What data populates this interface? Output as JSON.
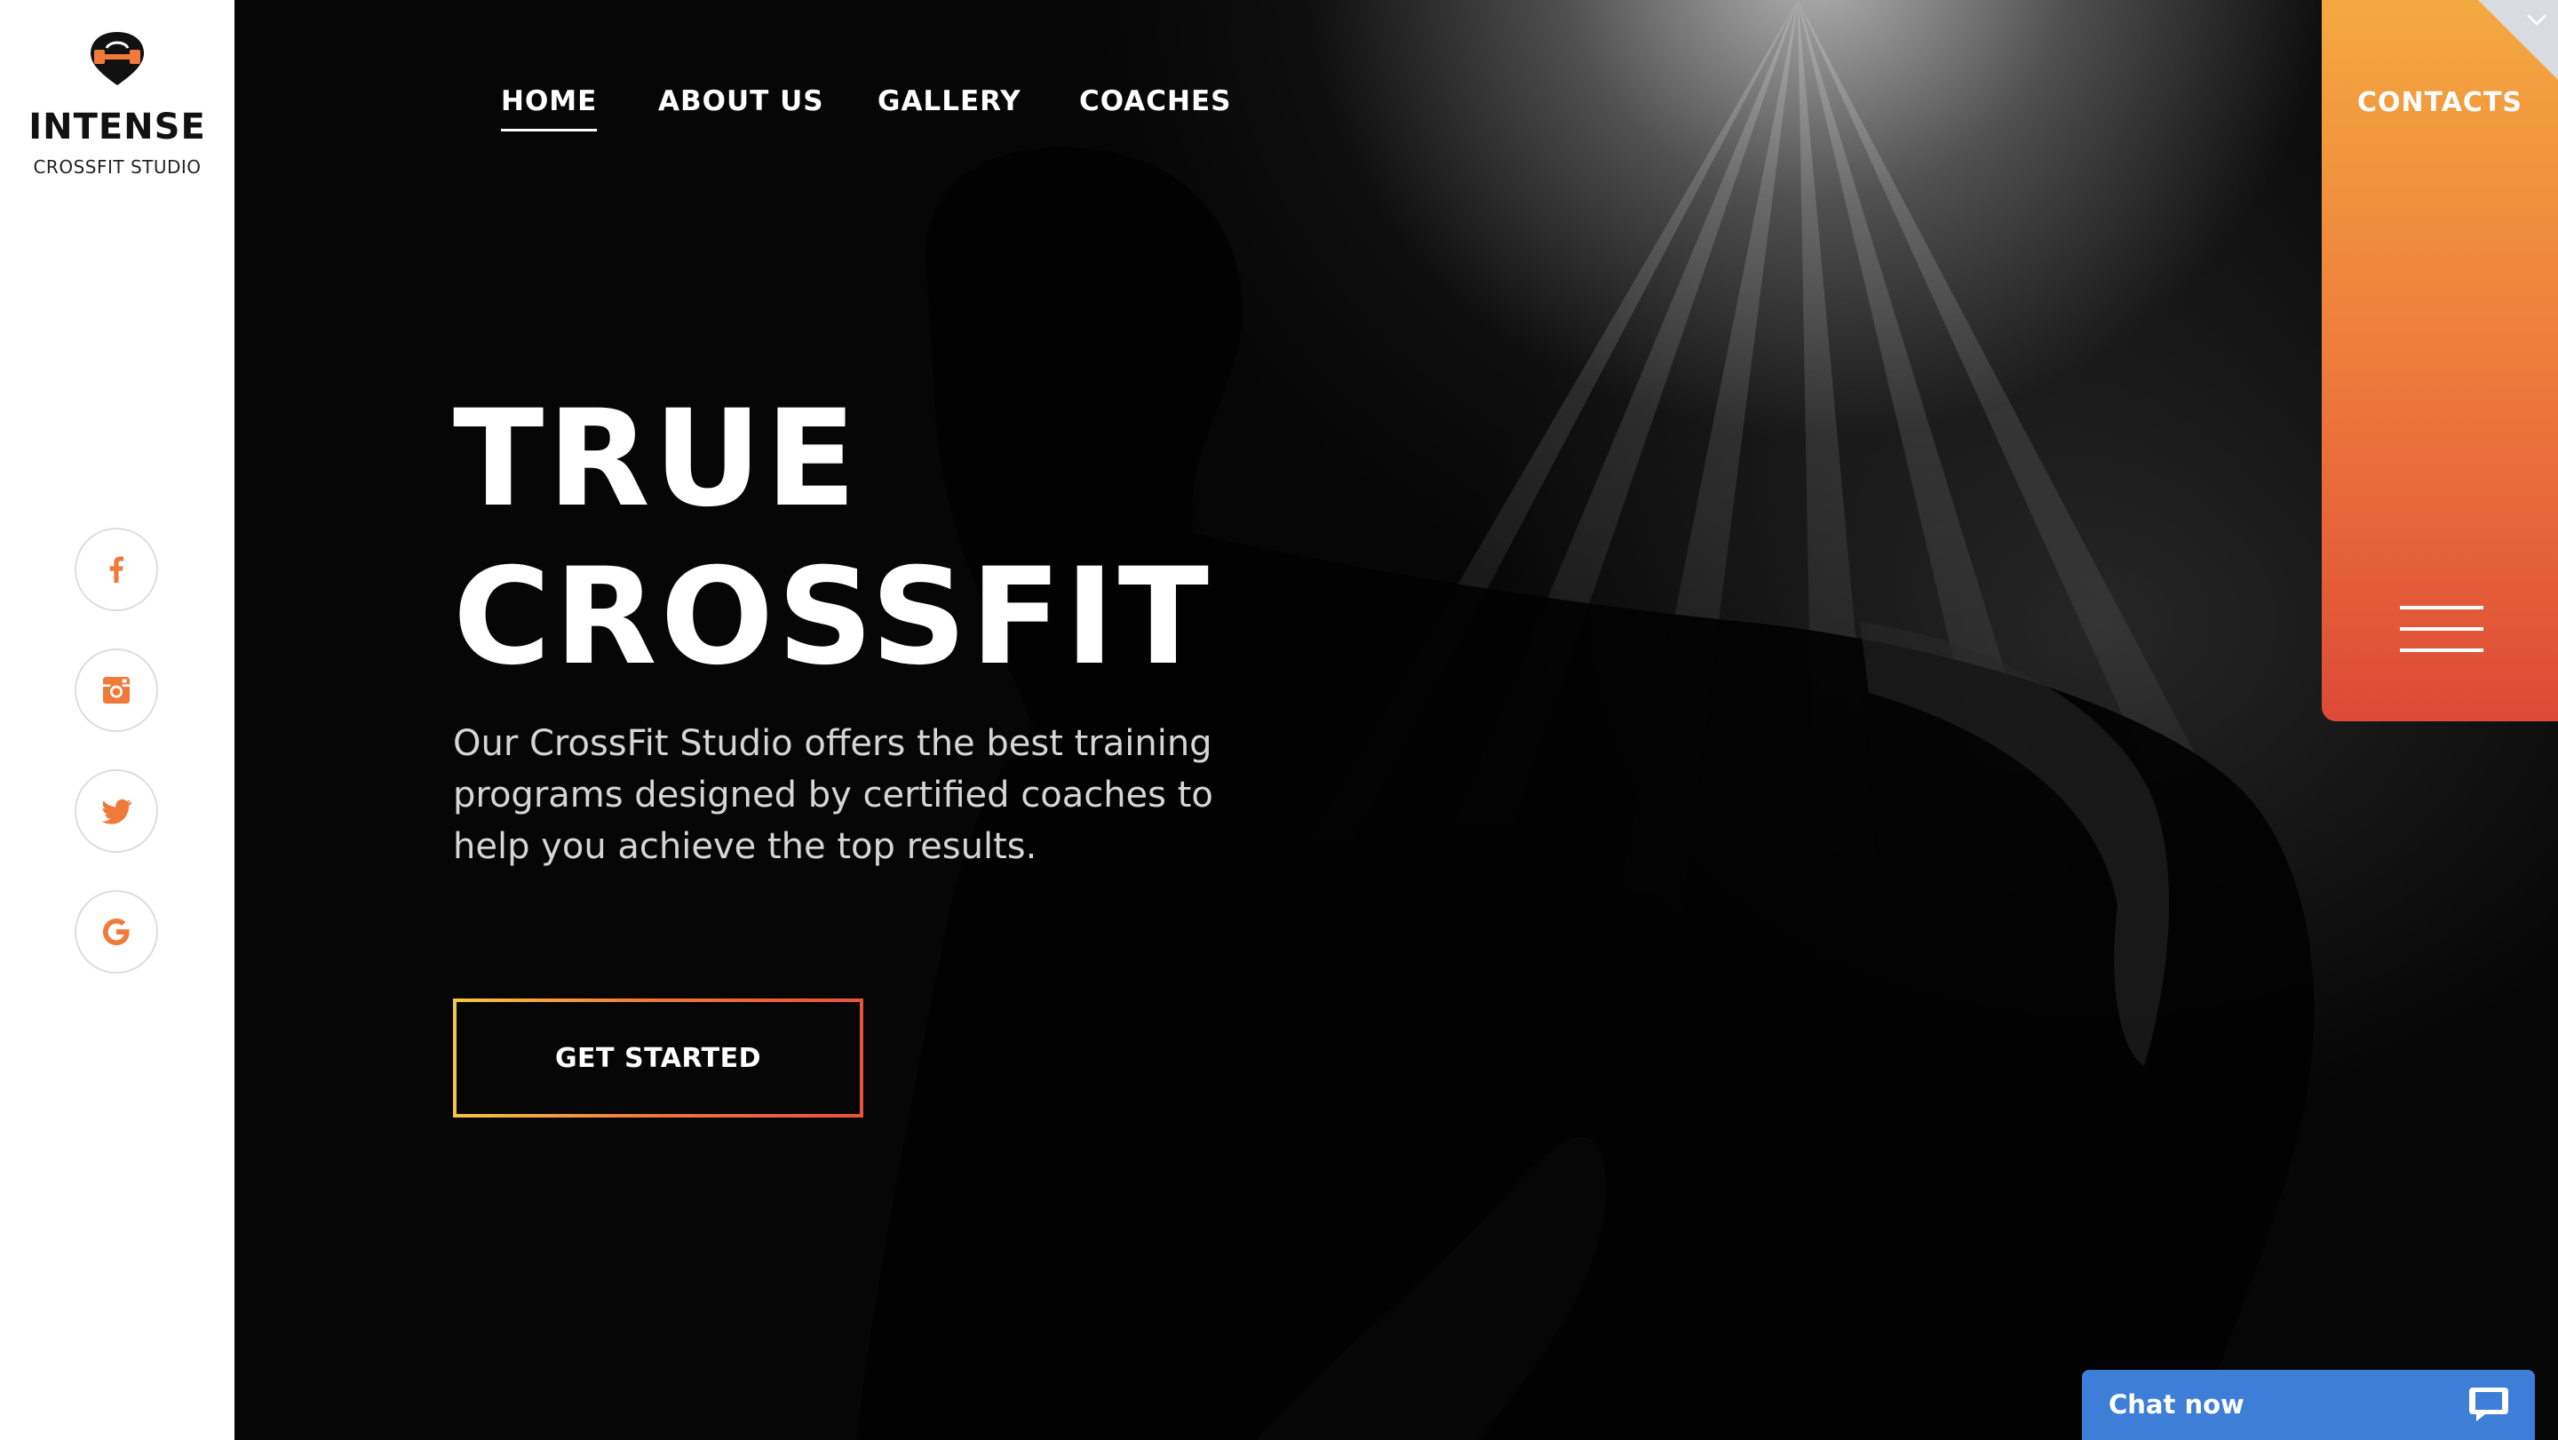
{
  "brand": {
    "name": "INTENSE",
    "subtitle": "CROSSFIT STUDIO"
  },
  "social": [
    {
      "icon": "facebook-icon"
    },
    {
      "icon": "instagram-icon"
    },
    {
      "icon": "twitter-icon"
    },
    {
      "icon": "google-icon"
    }
  ],
  "nav": {
    "items": [
      {
        "label": "HOME",
        "active": true
      },
      {
        "label": "ABOUT US",
        "active": false
      },
      {
        "label": "GALLERY",
        "active": false
      },
      {
        "label": "COACHES",
        "active": false
      }
    ],
    "contacts_label": "CONTACTS"
  },
  "hero": {
    "title_line1": "TRUE",
    "title_line2": "CROSSFIT",
    "text": "Our CrossFit Studio offers the best training programs designed by certified coaches to help you achieve the top results.",
    "cta_label": "GET STARTED"
  },
  "chat": {
    "label": "Chat now"
  },
  "colors": {
    "accent_orange": "#f07a3a",
    "accent_yellow": "#f6c443",
    "accent_red": "#dd4a37",
    "chat_blue": "#3f7ed6"
  }
}
